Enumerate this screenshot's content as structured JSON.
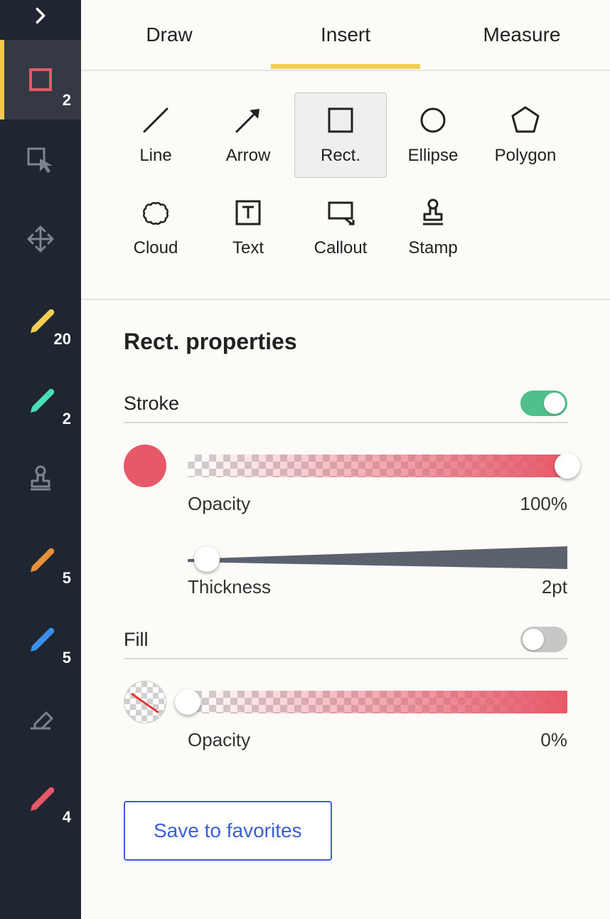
{
  "sidebar": {
    "tools": [
      {
        "name": "expand",
        "badge": null
      },
      {
        "name": "rect-tool",
        "badge": "2",
        "active": true,
        "accented": true,
        "color": "#e75868"
      },
      {
        "name": "select-tool",
        "badge": null
      },
      {
        "name": "move-tool",
        "badge": null
      },
      {
        "name": "pen-yellow",
        "badge": "20",
        "color": "#f2cf52"
      },
      {
        "name": "pen-teal",
        "badge": "2",
        "color": "#48e0b4"
      },
      {
        "name": "stamp-tool",
        "badge": null
      },
      {
        "name": "pen-orange",
        "badge": "5",
        "color": "#e9913a"
      },
      {
        "name": "pen-blue",
        "badge": "5",
        "color": "#3a8fe9"
      },
      {
        "name": "eraser-tool",
        "badge": null
      },
      {
        "name": "pen-red",
        "badge": "4",
        "color": "#e75868"
      }
    ]
  },
  "tabs": {
    "items": [
      "Draw",
      "Insert",
      "Measure"
    ],
    "active": 1
  },
  "shapes": [
    {
      "id": "line",
      "label": "Line"
    },
    {
      "id": "arrow",
      "label": "Arrow"
    },
    {
      "id": "rect",
      "label": "Rect.",
      "selected": true
    },
    {
      "id": "ellipse",
      "label": "Ellipse"
    },
    {
      "id": "polygon",
      "label": "Polygon"
    },
    {
      "id": "cloud",
      "label": "Cloud"
    },
    {
      "id": "text",
      "label": "Text"
    },
    {
      "id": "callout",
      "label": "Callout"
    },
    {
      "id": "stamp",
      "label": "Stamp"
    }
  ],
  "properties": {
    "title": "Rect. properties",
    "stroke": {
      "label": "Stroke",
      "enabled": true,
      "color": "#e75868",
      "opacity_label": "Opacity",
      "opacity_value": "100%",
      "opacity_pct": 100,
      "thickness_label": "Thickness",
      "thickness_value": "2pt",
      "thickness_pct": 5
    },
    "fill": {
      "label": "Fill",
      "enabled": false,
      "opacity_label": "Opacity",
      "opacity_value": "0%",
      "opacity_pct": 0
    },
    "save_label": "Save to favorites"
  }
}
